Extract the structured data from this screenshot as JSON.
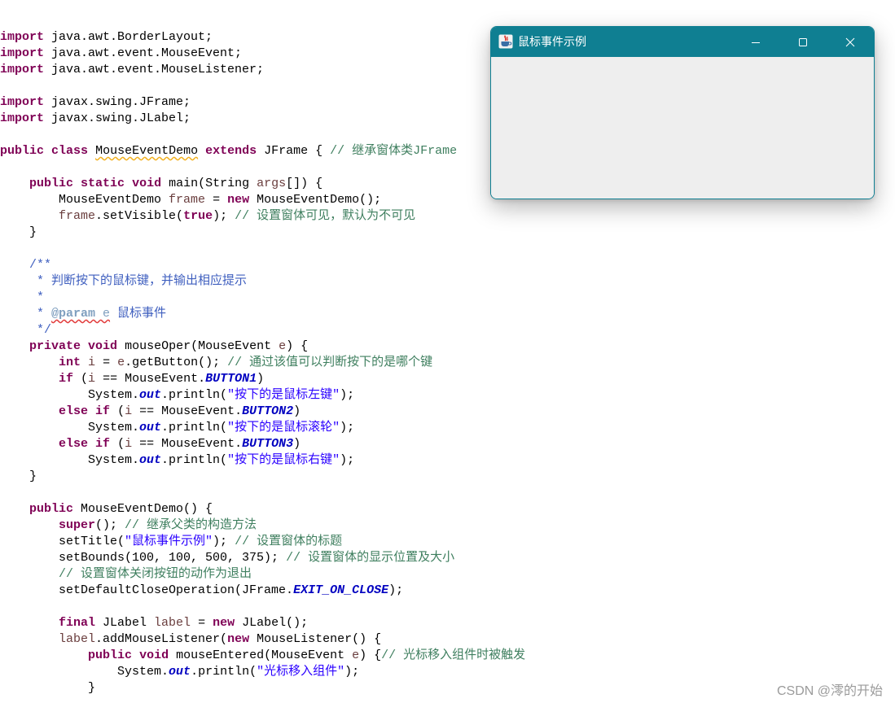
{
  "syntax_colors": {
    "plain": "#000000",
    "keyword": "#7F0055",
    "comment": "#3F7F5F",
    "javadoc": "#3F5FBF",
    "javadoc_tag": "#7F9FBF",
    "javadoc_arg": "#7F9FBF",
    "string": "#2A00FF",
    "constant": "#0000C0",
    "local_var": "#6A3E3E",
    "class_warning": "#000000",
    "warning_underline": "#F2B01E",
    "spelling_underline": "#E23B3B"
  },
  "editor": {
    "lines": [
      [
        [
          "keyword",
          "import"
        ],
        [
          "plain",
          " java.awt.BorderLayout;"
        ]
      ],
      [
        [
          "keyword",
          "import"
        ],
        [
          "plain",
          " java.awt.event.MouseEvent;"
        ]
      ],
      [
        [
          "keyword",
          "import"
        ],
        [
          "plain",
          " java.awt.event.MouseListener;"
        ]
      ],
      [],
      [
        [
          "keyword",
          "import"
        ],
        [
          "plain",
          " javax.swing.JFrame;"
        ]
      ],
      [
        [
          "keyword",
          "import"
        ],
        [
          "plain",
          " javax.swing.JLabel;"
        ]
      ],
      [],
      [
        [
          "keyword",
          "public"
        ],
        [
          "plain",
          " "
        ],
        [
          "keyword",
          "class"
        ],
        [
          "plain",
          " "
        ],
        [
          "class_warning",
          "MouseEventDemo"
        ],
        [
          "plain",
          " "
        ],
        [
          "keyword",
          "extends"
        ],
        [
          "plain",
          " JFrame { "
        ],
        [
          "comment",
          "// 继承窗体类JFrame"
        ]
      ],
      [],
      [
        [
          "plain",
          "    "
        ],
        [
          "keyword",
          "public"
        ],
        [
          "plain",
          " "
        ],
        [
          "keyword",
          "static"
        ],
        [
          "plain",
          " "
        ],
        [
          "keyword",
          "void"
        ],
        [
          "plain",
          " main(String "
        ],
        [
          "local_var",
          "args"
        ],
        [
          "plain",
          "[]) {"
        ]
      ],
      [
        [
          "plain",
          "        MouseEventDemo "
        ],
        [
          "local_var",
          "frame"
        ],
        [
          "plain",
          " = "
        ],
        [
          "keyword",
          "new"
        ],
        [
          "plain",
          " MouseEventDemo();"
        ]
      ],
      [
        [
          "plain",
          "        "
        ],
        [
          "local_var",
          "frame"
        ],
        [
          "plain",
          ".setVisible("
        ],
        [
          "keyword",
          "true"
        ],
        [
          "plain",
          "); "
        ],
        [
          "comment",
          "// 设置窗体可见，默认为不可见"
        ]
      ],
      [
        [
          "plain",
          "    }"
        ]
      ],
      [],
      [
        [
          "javadoc",
          "    /**"
        ]
      ],
      [
        [
          "javadoc",
          "     * 判断按下的鼠标键，并输出相应提示"
        ]
      ],
      [
        [
          "javadoc",
          "     *"
        ]
      ],
      [
        [
          "javadoc",
          "     * "
        ],
        [
          "javadoc_tag",
          "@param"
        ],
        [
          "javadoc_arg",
          " e"
        ],
        [
          "javadoc",
          " 鼠标事件"
        ]
      ],
      [
        [
          "javadoc",
          "     */"
        ]
      ],
      [
        [
          "plain",
          "    "
        ],
        [
          "keyword",
          "private"
        ],
        [
          "plain",
          " "
        ],
        [
          "keyword",
          "void"
        ],
        [
          "plain",
          " mouseOper(MouseEvent "
        ],
        [
          "local_var",
          "e"
        ],
        [
          "plain",
          ") {"
        ]
      ],
      [
        [
          "plain",
          "        "
        ],
        [
          "keyword",
          "int"
        ],
        [
          "plain",
          " "
        ],
        [
          "local_var",
          "i"
        ],
        [
          "plain",
          " = "
        ],
        [
          "local_var",
          "e"
        ],
        [
          "plain",
          ".getButton(); "
        ],
        [
          "comment",
          "// 通过该值可以判断按下的是哪个键"
        ]
      ],
      [
        [
          "plain",
          "        "
        ],
        [
          "keyword",
          "if"
        ],
        [
          "plain",
          " ("
        ],
        [
          "local_var",
          "i"
        ],
        [
          "plain",
          " == MouseEvent."
        ],
        [
          "constant",
          "BUTTON1"
        ],
        [
          "plain",
          ")"
        ]
      ],
      [
        [
          "plain",
          "            System."
        ],
        [
          "constant",
          "out"
        ],
        [
          "plain",
          ".println("
        ],
        [
          "string",
          "\"按下的是鼠标左键\""
        ],
        [
          "plain",
          ");"
        ]
      ],
      [
        [
          "plain",
          "        "
        ],
        [
          "keyword",
          "else"
        ],
        [
          "plain",
          " "
        ],
        [
          "keyword",
          "if"
        ],
        [
          "plain",
          " ("
        ],
        [
          "local_var",
          "i"
        ],
        [
          "plain",
          " == MouseEvent."
        ],
        [
          "constant",
          "BUTTON2"
        ],
        [
          "plain",
          ")"
        ]
      ],
      [
        [
          "plain",
          "            System."
        ],
        [
          "constant",
          "out"
        ],
        [
          "plain",
          ".println("
        ],
        [
          "string",
          "\"按下的是鼠标滚轮\""
        ],
        [
          "plain",
          ");"
        ]
      ],
      [
        [
          "plain",
          "        "
        ],
        [
          "keyword",
          "else"
        ],
        [
          "plain",
          " "
        ],
        [
          "keyword",
          "if"
        ],
        [
          "plain",
          " ("
        ],
        [
          "local_var",
          "i"
        ],
        [
          "plain",
          " == MouseEvent."
        ],
        [
          "constant",
          "BUTTON3"
        ],
        [
          "plain",
          ")"
        ]
      ],
      [
        [
          "plain",
          "            System."
        ],
        [
          "constant",
          "out"
        ],
        [
          "plain",
          ".println("
        ],
        [
          "string",
          "\"按下的是鼠标右键\""
        ],
        [
          "plain",
          ");"
        ]
      ],
      [
        [
          "plain",
          "    }"
        ]
      ],
      [],
      [
        [
          "plain",
          "    "
        ],
        [
          "keyword",
          "public"
        ],
        [
          "plain",
          " MouseEventDemo() {"
        ]
      ],
      [
        [
          "plain",
          "        "
        ],
        [
          "keyword",
          "super"
        ],
        [
          "plain",
          "(); "
        ],
        [
          "comment",
          "// 继承父类的构造方法"
        ]
      ],
      [
        [
          "plain",
          "        setTitle("
        ],
        [
          "string",
          "\"鼠标事件示例\""
        ],
        [
          "plain",
          "); "
        ],
        [
          "comment",
          "// 设置窗体的标题"
        ]
      ],
      [
        [
          "plain",
          "        setBounds(100, 100, 500, 375); "
        ],
        [
          "comment",
          "// 设置窗体的显示位置及大小"
        ]
      ],
      [
        [
          "plain",
          "        "
        ],
        [
          "comment",
          "// 设置窗体关闭按钮的动作为退出"
        ]
      ],
      [
        [
          "plain",
          "        setDefaultCloseOperation(JFrame."
        ],
        [
          "constant",
          "EXIT_ON_CLOSE"
        ],
        [
          "plain",
          ");"
        ]
      ],
      [],
      [
        [
          "plain",
          "        "
        ],
        [
          "keyword",
          "final"
        ],
        [
          "plain",
          " JLabel "
        ],
        [
          "local_var",
          "label"
        ],
        [
          "plain",
          " = "
        ],
        [
          "keyword",
          "new"
        ],
        [
          "plain",
          " JLabel();"
        ]
      ],
      [
        [
          "plain",
          "        "
        ],
        [
          "local_var",
          "label"
        ],
        [
          "plain",
          ".addMouseListener("
        ],
        [
          "keyword",
          "new"
        ],
        [
          "plain",
          " MouseListener() {"
        ]
      ],
      [
        [
          "plain",
          "            "
        ],
        [
          "keyword",
          "public"
        ],
        [
          "plain",
          " "
        ],
        [
          "keyword",
          "void"
        ],
        [
          "plain",
          " mouseEntered(MouseEvent "
        ],
        [
          "local_var",
          "e"
        ],
        [
          "plain",
          ") {"
        ],
        [
          "comment",
          "// 光标移入组件时被触发"
        ]
      ],
      [
        [
          "plain",
          "                System."
        ],
        [
          "constant",
          "out"
        ],
        [
          "plain",
          ".println("
        ],
        [
          "string",
          "\"光标移入组件\""
        ],
        [
          "plain",
          ");"
        ]
      ],
      [
        [
          "plain",
          "            }"
        ]
      ]
    ]
  },
  "window": {
    "title": "鼠标事件示例",
    "icon": "java-app-icon",
    "title_bar_color": "#0F7F92",
    "content_color": "#EEEEEE",
    "controls": {
      "minimize": "minimize-icon",
      "maximize": "maximize-icon",
      "close": "close-icon"
    }
  },
  "watermark": "CSDN @澪的开始"
}
